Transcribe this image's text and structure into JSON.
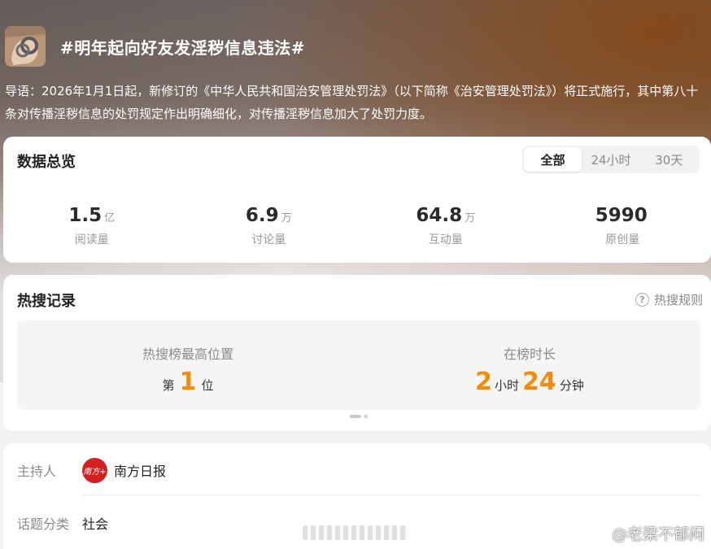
{
  "topic": {
    "title": "#明年起向好友发淫秽信息违法#",
    "guide": "导语：2026年1月1日起，新修订的《中华人民共和国治安管理处罚法》（以下简称《治安管理处罚法》）将正式施行，其中第八十条对传播淫秽信息的处罚规定作出明确细化，对传播淫秽信息加大了处罚力度。"
  },
  "overview": {
    "title": "数据总览",
    "tabs": [
      {
        "label": "全部",
        "active": true
      },
      {
        "label": "24小时",
        "active": false
      },
      {
        "label": "30天",
        "active": false
      }
    ],
    "stats": [
      {
        "value": "1.5",
        "unit": "亿",
        "label": "阅读量"
      },
      {
        "value": "6.9",
        "unit": "万",
        "label": "讨论量"
      },
      {
        "value": "64.8",
        "unit": "万",
        "label": "互动量"
      },
      {
        "value": "5990",
        "unit": "",
        "label": "原创量"
      }
    ]
  },
  "hot_search": {
    "title": "热搜记录",
    "rules_label": "热搜规则",
    "rules_icon": "question-circle-icon",
    "highest_position": {
      "label": "热搜榜最高位置",
      "prefix": "第",
      "value": "1",
      "suffix": "位"
    },
    "duration": {
      "label": "在榜时长",
      "hours": "2",
      "hours_unit": "小时",
      "minutes": "24",
      "minutes_unit": "分钟"
    }
  },
  "info": {
    "host_label": "主持人",
    "host_name": "南方日报",
    "host_avatar_text": "南方+",
    "category_label": "话题分类",
    "category_value": "社会"
  },
  "watermark": {
    "text": "@老梁不郁闷"
  },
  "colors": {
    "accent": "#f28d0c",
    "host_avatar": "#d21f1f"
  }
}
